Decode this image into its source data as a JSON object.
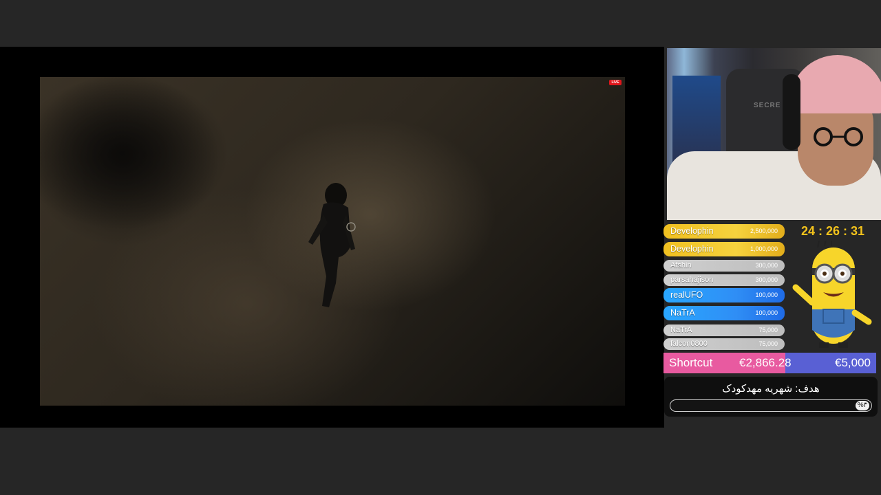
{
  "stream": {
    "live_badge": "LIVE"
  },
  "webcam": {
    "chair_brand": "SECRE"
  },
  "leaderboard": [
    {
      "name": "Develophin",
      "amount": "2,500,000",
      "style": "gold"
    },
    {
      "name": "Develophin",
      "amount": "1,000,000",
      "style": "gold"
    },
    {
      "name": "Afshin",
      "amount": "300,000",
      "style": "gray"
    },
    {
      "name": "parsahajison",
      "amount": "300,000",
      "style": "gray"
    },
    {
      "name": "realUFO",
      "amount": "100,000",
      "style": "blue"
    },
    {
      "name": "NaTrA",
      "amount": "100,000",
      "style": "blue"
    },
    {
      "name": "NaTrA",
      "amount": "75,000",
      "style": "gray"
    },
    {
      "name": "falcon0800",
      "amount": "75,000",
      "style": "gray"
    }
  ],
  "timer": {
    "value": "24 : 26 : 31"
  },
  "goal": {
    "name": "Shortcut",
    "current": "€2,866.28",
    "target": "€5,000",
    "progress_fraction": 0.573,
    "fill_color": "#e85aa0",
    "track_color": "#5960d4"
  },
  "donation_goal": {
    "title": "هدف: شهریه مهدکودک",
    "percent_label": "%۳",
    "progress_fraction": 0.03
  }
}
